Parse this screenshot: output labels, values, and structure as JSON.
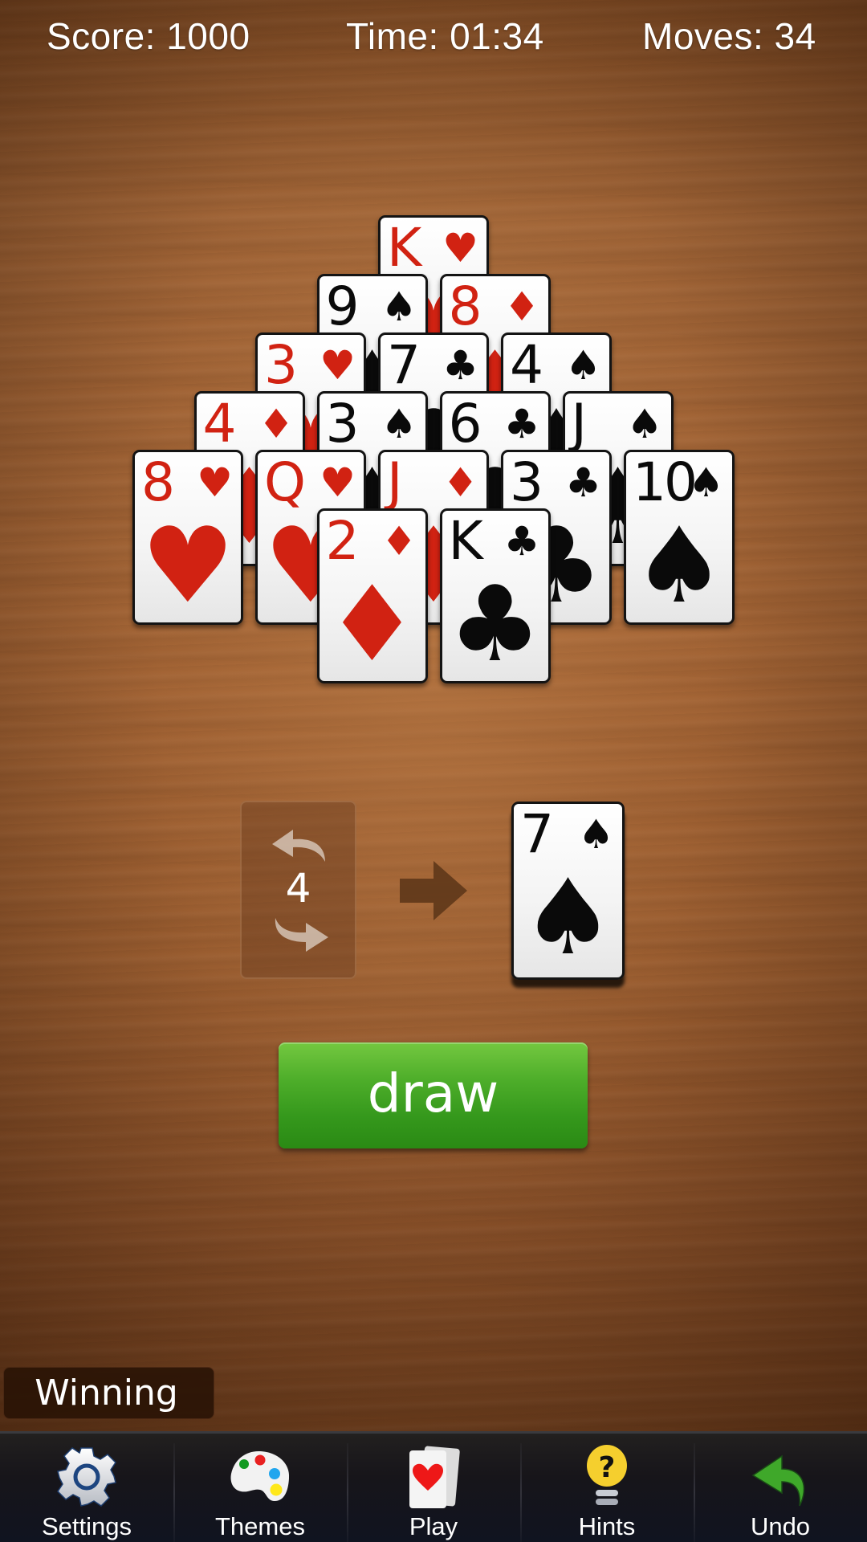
{
  "hud": {
    "score": "Score: 1000",
    "time": "Time: 01:34",
    "moves": "Moves: 34"
  },
  "pyramid": {
    "rows": [
      [
        {
          "rank": "K",
          "suit": "hearts",
          "symbol": "♥",
          "color": "red"
        }
      ],
      [
        {
          "rank": "9",
          "suit": "spades",
          "symbol": "♠",
          "color": "black"
        },
        {
          "rank": "8",
          "suit": "diamonds",
          "symbol": "♦",
          "color": "red"
        }
      ],
      [
        {
          "rank": "3",
          "suit": "hearts",
          "symbol": "♥",
          "color": "red"
        },
        {
          "rank": "7",
          "suit": "clubs",
          "symbol": "♣",
          "color": "black"
        },
        {
          "rank": "4",
          "suit": "spades",
          "symbol": "♠",
          "color": "black"
        }
      ],
      [
        {
          "rank": "4",
          "suit": "diamonds",
          "symbol": "♦",
          "color": "red"
        },
        {
          "rank": "3",
          "suit": "spades",
          "symbol": "♠",
          "color": "black"
        },
        {
          "rank": "6",
          "suit": "clubs",
          "symbol": "♣",
          "color": "black"
        },
        {
          "rank": "J",
          "suit": "spades",
          "symbol": "♠",
          "color": "black"
        }
      ],
      [
        {
          "rank": "8",
          "suit": "hearts",
          "symbol": "♥",
          "color": "red"
        },
        {
          "rank": "Q",
          "suit": "hearts",
          "symbol": "♥",
          "color": "red"
        },
        {
          "rank": "J",
          "suit": "diamonds",
          "symbol": "♦",
          "color": "red"
        },
        {
          "rank": "3",
          "suit": "clubs",
          "symbol": "♣",
          "color": "black"
        },
        {
          "rank": "10",
          "suit": "spades",
          "symbol": "♠",
          "color": "black"
        }
      ],
      [
        {
          "rank": "2",
          "suit": "diamonds",
          "symbol": "♦",
          "color": "red"
        },
        {
          "rank": "K",
          "suit": "clubs",
          "symbol": "♣",
          "color": "black"
        }
      ]
    ]
  },
  "stock": {
    "recycles_left": "4",
    "icon": "recycle-arrows-icon"
  },
  "waste": {
    "rank": "7",
    "suit": "spades",
    "symbol": "♠",
    "color": "black"
  },
  "draw_button": {
    "label": "draw",
    "color": "#3da322"
  },
  "status_badge": {
    "label": "Winning"
  },
  "navbar": {
    "items": [
      {
        "label": "Settings",
        "icon": "gear-icon"
      },
      {
        "label": "Themes",
        "icon": "palette-icon"
      },
      {
        "label": "Play",
        "icon": "cards-icon"
      },
      {
        "label": "Hints",
        "icon": "lightbulb-icon"
      },
      {
        "label": "Undo",
        "icon": "undo-arrow-icon"
      }
    ]
  },
  "colors": {
    "red_suit": "#d12212",
    "black_suit": "#0a0a0a",
    "table_wood": "#a0663a",
    "navbar_bg": "#17151a"
  }
}
